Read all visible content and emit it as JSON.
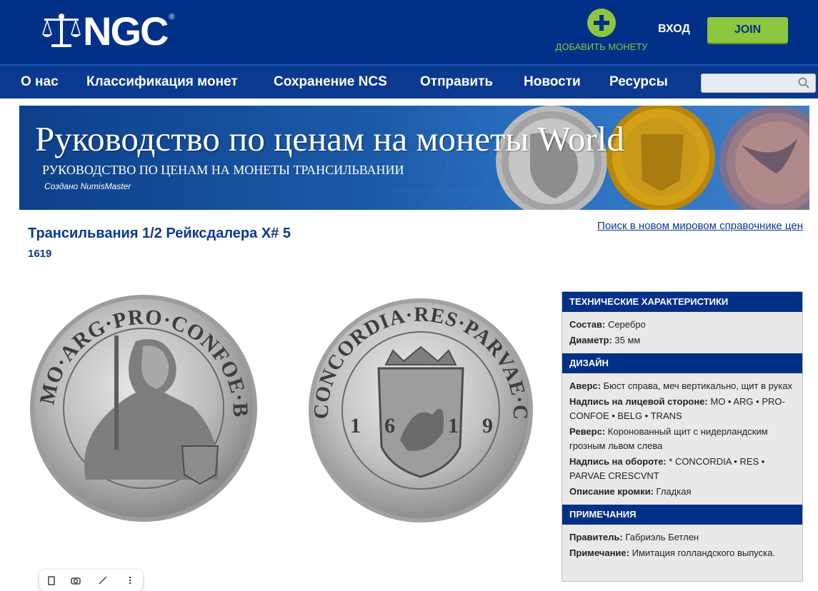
{
  "header": {
    "logo_text": "NGC",
    "logo_reg": "®",
    "add_coin_label": "ДОБАВИТЬ МОНЕТУ",
    "login_label": "ВХОД",
    "join_label": "JOIN"
  },
  "nav": {
    "items": [
      {
        "label": "О нас"
      },
      {
        "label": "Классификация монет"
      },
      {
        "label": "Сохранение NCS"
      },
      {
        "label": "Отправить"
      },
      {
        "label": "Новости"
      },
      {
        "label": "Ресурсы"
      }
    ],
    "search_placeholder": ""
  },
  "banner": {
    "title": "Руководство по ценам на монеты World",
    "subtitle": "РУКОВОДСТВО ПО ЦЕНАМ НА МОНЕТЫ ТРАНСИЛЬВАНИИ",
    "credit": "Создано NumisMaster"
  },
  "coin": {
    "title": "Трансильвания 1/2 Рейксдалера X# 5",
    "year": "1619",
    "search_link": "Поиск в новом мировом справочнике цен",
    "obverse_legend": "MO·ARG·PRO·CONFOE·BELG·TRANS",
    "reverse_legend": "CONCORDIA·RES·PARVAE·CRESCVNT",
    "reverse_date": "16 19"
  },
  "specs": {
    "tech_header": "ТЕХНИЧЕСКИЕ ХАРАКТЕРИСТИКИ",
    "composition_label": "Состав:",
    "composition_value": "Серебро",
    "diameter_label": "Диаметр:",
    "diameter_value": "35 мм",
    "design_header": "ДИЗАЙН",
    "obverse_label": "Аверс:",
    "obverse_value": "Бюст справа, меч вертикально, щит в руках",
    "obverse_legend_label": "Надпись на лицевой стороне:",
    "obverse_legend_value": "MO • ARG • PRO-CONFOE • BELG • TRANS",
    "reverse_label": "Реверс:",
    "reverse_value": "Коронованный щит с нидерландским грозным львом слева",
    "reverse_legend_label": "Надпись на обороте:",
    "reverse_legend_value": "* CONCORDIA • RES • PARVAE CRESCVNT",
    "edge_label": "Описание кромки:",
    "edge_value": "Гладкая",
    "notes_header": "ПРИМЕЧАНИЯ",
    "ruler_label": "Правитель:",
    "ruler_value": "Габриэль Бетлен",
    "note_label": "Примечание:",
    "note_value": "Имитация голландского выпуска."
  },
  "colors": {
    "primary": "#003087",
    "accent": "#8dc63f"
  }
}
